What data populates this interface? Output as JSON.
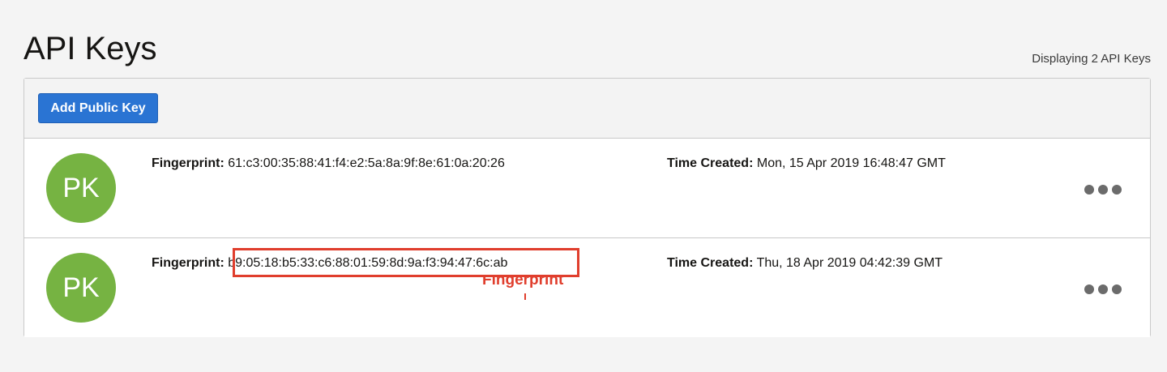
{
  "header": {
    "title": "API Keys",
    "count_text": "Displaying 2 API Keys"
  },
  "toolbar": {
    "add_label": "Add Public Key"
  },
  "keys": [
    {
      "avatar": "PK",
      "fingerprint_label": "Fingerprint:",
      "fingerprint": "61:c3:00:35:88:41:f4:e2:5a:8a:9f:8e:61:0a:20:26",
      "time_label": "Time Created:",
      "time_created": "Mon, 15 Apr 2019 16:48:47 GMT",
      "menu_icon": "more-horizontal-icon"
    },
    {
      "avatar": "PK",
      "fingerprint_label": "Fingerprint:",
      "fingerprint": "b9:05:18:b5:33:c6:88:01:59:8d:9a:f3:94:47:6c:ab",
      "time_label": "Time Created:",
      "time_created": "Thu, 18 Apr 2019 04:42:39 GMT",
      "menu_icon": "more-horizontal-icon"
    }
  ],
  "annotation": {
    "label": "Fingerprint",
    "color": "#e03e2d"
  },
  "colors": {
    "primary_button": "#2a74d3",
    "avatar": "#76b342"
  }
}
